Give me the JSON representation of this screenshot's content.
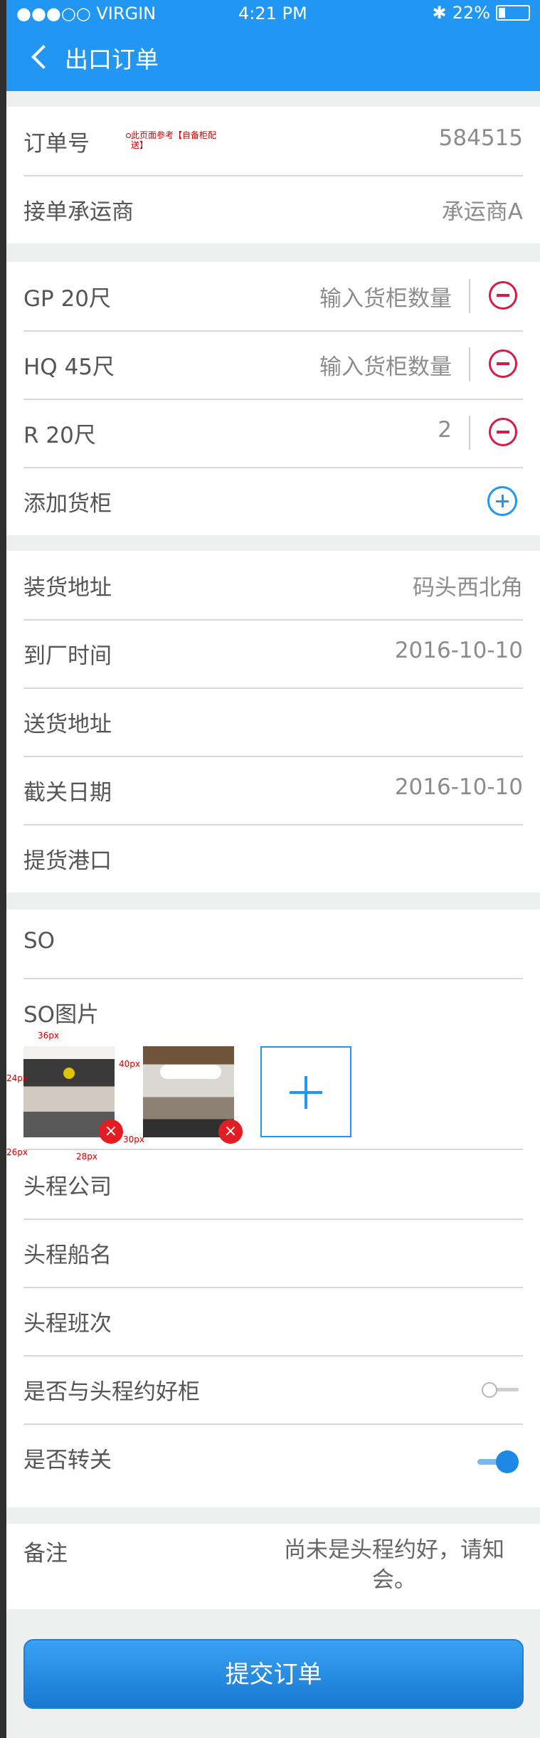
{
  "status_bar": {
    "carrier": "●●●○○ VIRGIN",
    "time": "4:21 PM",
    "battery_text": "22%",
    "battery_level": 0.22
  },
  "nav": {
    "back_icon": "chevron-left-icon",
    "title": "出口订单"
  },
  "order": {
    "order_label": "订单号",
    "order_number": "584515",
    "note": [
      "此页面参考【自备柜配",
      "送】"
    ],
    "carrier_label": "接单承运商",
    "carrier_value": "承运商A"
  },
  "containers": {
    "items": [
      {
        "label": "GP 20尺",
        "placeholder": "输入货柜数量",
        "value": ""
      },
      {
        "label": "HQ 45尺",
        "placeholder": "输入货柜数量",
        "value": ""
      },
      {
        "label": "R 20尺",
        "placeholder": "",
        "value": "2"
      }
    ],
    "add_label": "添加货柜"
  },
  "shipment": {
    "loading_address": {
      "label": "装货地址",
      "value": "码头西北角"
    },
    "arrival_time": {
      "label": "到厂时间",
      "value": "2016-10-10"
    },
    "delivery_address": {
      "label": "送货地址",
      "value": ""
    },
    "cutoff_date": {
      "label": "截关日期",
      "value": "2016-10-10"
    },
    "pickup_port": {
      "label": "提货港口",
      "value": ""
    }
  },
  "so": {
    "so_label": "SO",
    "so_images_label": "SO图片",
    "images": [
      {
        "name": "office-photo-1"
      },
      {
        "name": "office-photo-2"
      }
    ],
    "measurements": [
      "36px",
      "24px",
      "40px",
      "26px",
      "28px",
      "30px"
    ]
  },
  "first_leg": {
    "company_label": "头程公司",
    "vessel_label": "头程船名",
    "voyage_label": "头程班次",
    "reserved_label": "是否与头程约好柜",
    "reserved_on": false,
    "customs_label": "是否转关",
    "customs_on": true
  },
  "remark": {
    "label": "备注",
    "text": "尚未是头程约好，请知会。"
  },
  "submit_label": "提交订单",
  "colors": {
    "primary": "#2196f3",
    "danger": "#d61b46",
    "background": "#eef0f0"
  }
}
